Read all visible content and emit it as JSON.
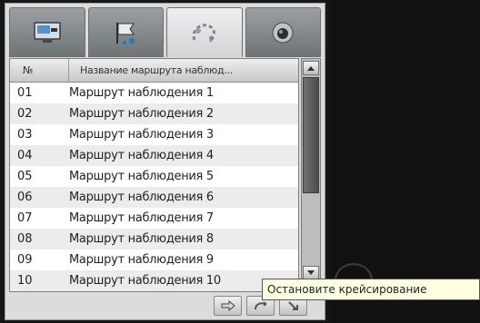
{
  "tabs": [
    {
      "icon": "monitor-icon",
      "active": false
    },
    {
      "icon": "flag-icon",
      "active": false
    },
    {
      "icon": "route-icon",
      "active": true
    },
    {
      "icon": "dome-camera-icon",
      "active": false
    }
  ],
  "list": {
    "header": {
      "number": "№",
      "name": "Название маршрута наблюд..."
    },
    "rows": [
      {
        "number": "01",
        "name": "Маршрут наблюдения 1"
      },
      {
        "number": "02",
        "name": "Маршрут наблюдения 2"
      },
      {
        "number": "03",
        "name": "Маршрут наблюдения 3"
      },
      {
        "number": "04",
        "name": "Маршрут наблюдения 4"
      },
      {
        "number": "05",
        "name": "Маршрут наблюдения 5"
      },
      {
        "number": "06",
        "name": "Маршрут наблюдения 6"
      },
      {
        "number": "07",
        "name": "Маршрут наблюдения 7"
      },
      {
        "number": "08",
        "name": "Маршрут наблюдения 8"
      },
      {
        "number": "09",
        "name": "Маршрут наблюдения 9"
      },
      {
        "number": "10",
        "name": "Маршрут наблюдения 10"
      }
    ]
  },
  "scrollbar": {
    "position": 0.0
  },
  "toolbar": {
    "buttons": [
      "arrow-right-icon",
      "stop-cruise-icon",
      "next-route-icon"
    ]
  },
  "tooltip": {
    "text": "Остановите крейсирование"
  },
  "colors": {
    "accent": "#2a76c6",
    "video_background": "#111111"
  }
}
